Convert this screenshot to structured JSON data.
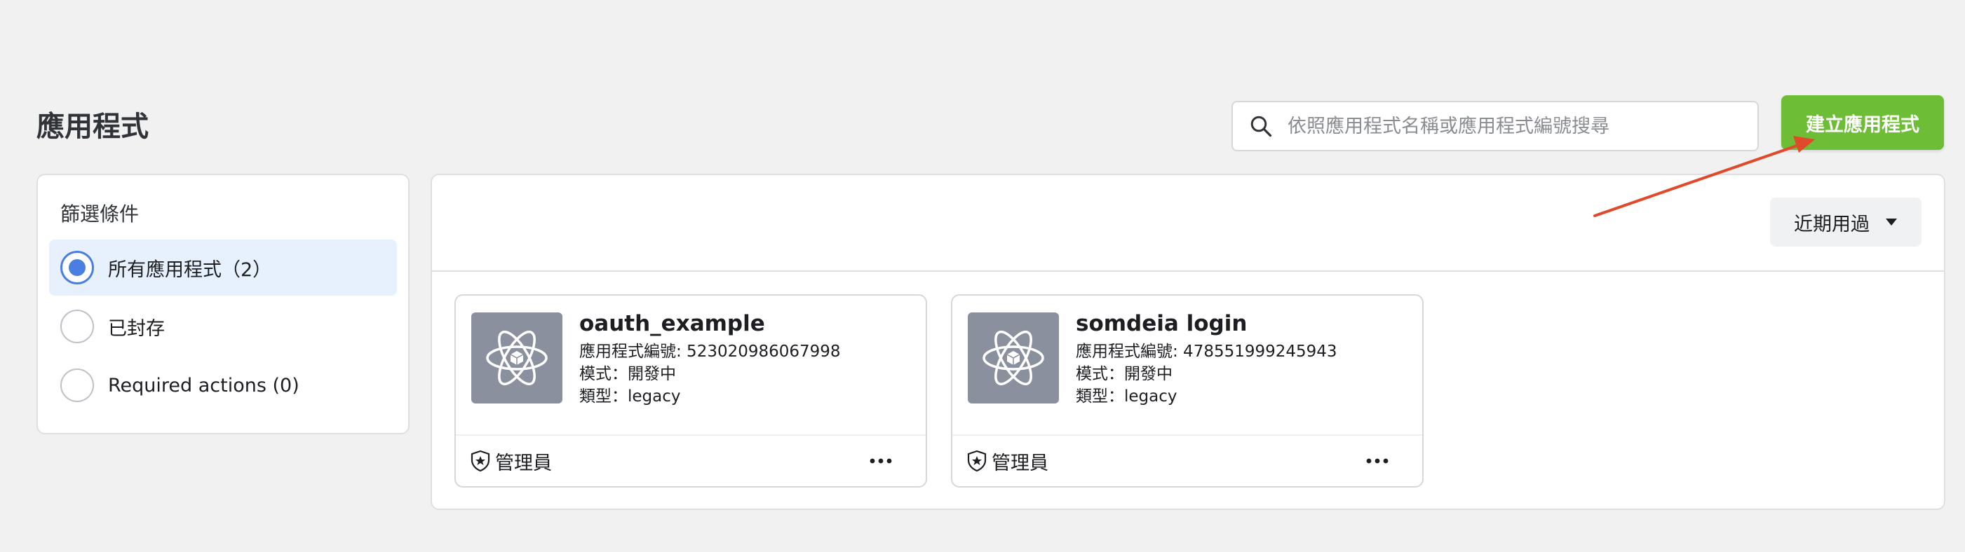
{
  "page": {
    "title": "應用程式"
  },
  "search": {
    "placeholder": "依照應用程式名稱或應用程式編號搜尋",
    "value": ""
  },
  "create_button": {
    "label": "建立應用程式",
    "color": "#6ebd36"
  },
  "filters": {
    "title": "篩選條件",
    "options": [
      {
        "label": "所有應用程式（2）",
        "selected": true
      },
      {
        "label": "已封存",
        "selected": false
      },
      {
        "label": "Required actions (0)",
        "selected": false
      }
    ]
  },
  "sort": {
    "label": "近期用過"
  },
  "apps": [
    {
      "name": "oauth_example",
      "id_line": "應用程式編號: 523020986067998",
      "mode_line": "模式：開發中",
      "type_line": "類型：legacy",
      "role": "管理員"
    },
    {
      "name": "somdeia login",
      "id_line": "應用程式編號: 478551999245943",
      "mode_line": "模式：開發中",
      "type_line": "類型：legacy",
      "role": "管理員"
    }
  ],
  "annotation": {
    "arrow_color": "#e04a2a"
  }
}
